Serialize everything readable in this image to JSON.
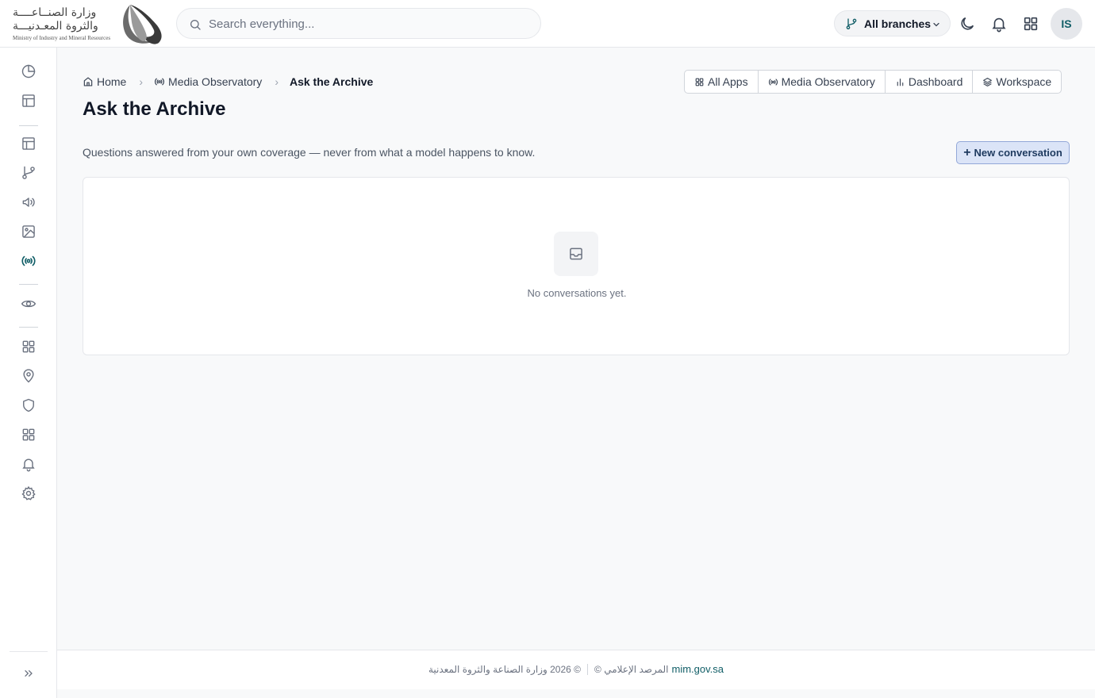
{
  "header": {
    "logo": {
      "arabic_line1": "وزارة الصنــاعــــة",
      "arabic_line2": "والثروة المعـدنيـــة",
      "english": "Ministry of Industry and Mineral Resources"
    },
    "search": {
      "placeholder": "Search everything..."
    },
    "branch_selector": {
      "label": "All branches"
    },
    "avatar": {
      "initials": "IS"
    }
  },
  "breadcrumb": {
    "items": [
      {
        "label": "Home",
        "icon": "home-icon"
      },
      {
        "label": "Media Observatory",
        "icon": "broadcast-icon"
      },
      {
        "label": "Ask the Archive"
      }
    ]
  },
  "app_switcher": {
    "items": [
      {
        "label": "All Apps",
        "icon": "grid-icon"
      },
      {
        "label": "Media Observatory",
        "icon": "broadcast-icon"
      },
      {
        "label": "Dashboard",
        "icon": "bar-chart-icon"
      },
      {
        "label": "Workspace",
        "icon": "layers-icon"
      }
    ]
  },
  "page": {
    "title": "Ask the Archive",
    "subtitle": "Questions answered from your own coverage — never from what a model happens to know.",
    "new_conversation_label": "New conversation",
    "empty_state": "No conversations yet."
  },
  "sidebar": {
    "items": [
      {
        "icon": "pie-chart-icon"
      },
      {
        "icon": "layout-icon"
      },
      {
        "icon": "layout-icon"
      },
      {
        "icon": "git-branch-icon"
      },
      {
        "icon": "megaphone-icon"
      },
      {
        "icon": "image-icon"
      },
      {
        "icon": "broadcast-icon",
        "active": true
      },
      {
        "icon": "eye-icon"
      },
      {
        "icon": "grid-icon"
      },
      {
        "icon": "map-pin-icon"
      },
      {
        "icon": "shield-icon"
      },
      {
        "icon": "grid-icon"
      },
      {
        "icon": "bell-icon"
      },
      {
        "icon": "settings-icon"
      }
    ],
    "collapse_icon": "chevrons-right-icon"
  },
  "footer": {
    "copyright_ar": "© 2026 وزارة الصناعة والثروة المعدنية",
    "observatory_ar": "المرصد الإعلامي ©",
    "link": "mim.gov.sa"
  },
  "colors": {
    "accent": "#115e67",
    "new_conversation_bg": "#dbe4f7",
    "new_conversation_border": "#93a8d8"
  }
}
